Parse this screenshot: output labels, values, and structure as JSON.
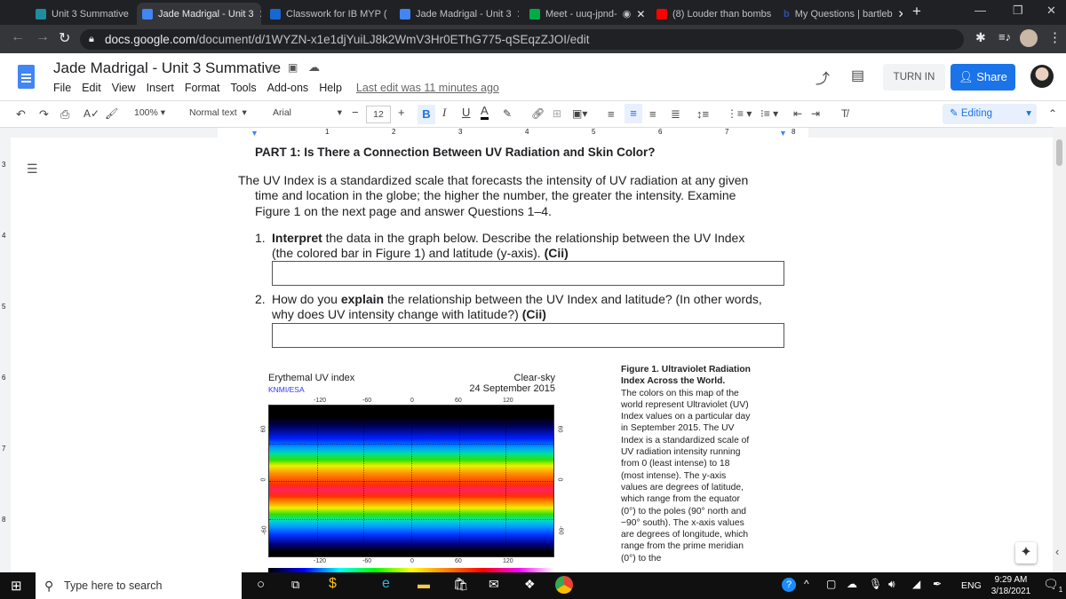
{
  "browser": {
    "tabs": [
      {
        "label": "Unit 3 Summative",
        "icon": "classroom-icon",
        "color": "#1e8e9e"
      },
      {
        "label": "Jade Madrigal - Unit 3",
        "icon": "docs-icon",
        "color": "#4285f4",
        "active": true
      },
      {
        "label": "Classwork for IB MYP (",
        "icon": "classroom-icon",
        "color": "#1967d2"
      },
      {
        "label": "Jade Madrigal - Unit 3",
        "icon": "docs-icon",
        "color": "#4285f4"
      },
      {
        "label": "Meet - uuq-jpnd-",
        "icon": "meet-icon",
        "color": "#00ac47"
      },
      {
        "label": "(8) Louder than bombs",
        "icon": "youtube-icon",
        "color": "#ff0000"
      },
      {
        "label": "My Questions | bartleb",
        "icon": "bartleby-icon",
        "color": "#1a237e"
      }
    ],
    "url_domain": "docs.google.com",
    "url_path": "/document/d/1WYZN-x1e1djYuiLJ8k2WmV3Hr0EThG775-qSEqzZJOI/edit"
  },
  "docs": {
    "title": "Jade Madrigal - Unit 3 Summative",
    "menu": [
      "File",
      "Edit",
      "View",
      "Insert",
      "Format",
      "Tools",
      "Add-ons",
      "Help"
    ],
    "last_edit": "Last edit was 11 minutes ago",
    "turn_in": "TURN IN",
    "share": "Share",
    "toolbar": {
      "zoom": "100%",
      "style": "Normal text",
      "font": "Arial",
      "size": "12",
      "mode": "Editing"
    },
    "ruler": [
      "1",
      "2",
      "3",
      "4",
      "5",
      "6",
      "7",
      "8"
    ],
    "vruler": [
      "3",
      "4",
      "5",
      "6",
      "7",
      "8"
    ]
  },
  "content": {
    "heading": "PART 1: Is There a Connection Between UV Radiation and Skin Color?",
    "intro": "The UV Index is a standardized scale that forecasts the intensity of UV radiation at any given time and location in the globe; the higher the number, the greater the intensity. Examine Figure 1 on the next page and answer Questions 1–4.",
    "q1": {
      "num": "1.",
      "bold1": "Interpret",
      "text1": " the data in the graph below. Describe the relationship between the UV Index (the colored bar in Figure 1) and latitude (y-axis). ",
      "tag": "(Cii)"
    },
    "q2": {
      "num": "2.",
      "text0": "How do you ",
      "bold1": "explain",
      "text1": " the relationship between the UV Index and latitude? (In other words, why does UV intensity change with latitude?) ",
      "tag": "(Cii)"
    },
    "figure": {
      "title": "Erythemal UV index",
      "source": "KNMI/ESA",
      "subtitle": "Clear-sky",
      "date": "24 September 2015",
      "x_ticks": [
        "-120",
        "-60",
        "0",
        "60",
        "120"
      ],
      "y_ticks": [
        "60",
        "0",
        "-60"
      ]
    },
    "caption_title": "Figure 1. Ultraviolet Radiation Index Across the World.",
    "caption_body": "The colors on this map of the world represent Ultraviolet (UV) Index values on a particular day in September 2015. The UV Index is a standardized scale of UV radiation intensity running from 0 (least intense) to 18 (most intense). The y-axis values are degrees of latitude, which range from the equator (0°) to the poles (90° north and −90° south). The x-axis values are degrees of longitude, which range from the prime meridian (0°) to the"
  },
  "taskbar": {
    "search": "Type here to search",
    "lang": "ENG",
    "time": "9:29 AM",
    "date": "3/18/2021",
    "notifications": "1"
  }
}
